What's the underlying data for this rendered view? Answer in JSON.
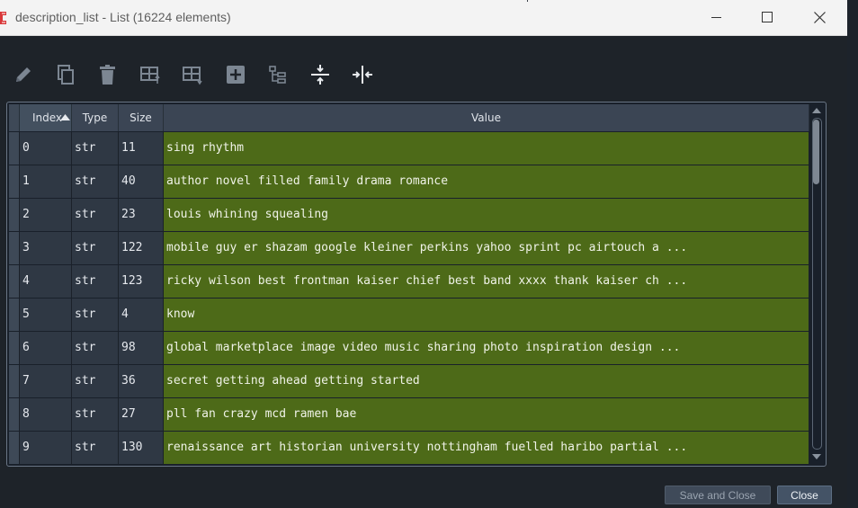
{
  "window": {
    "title": "description_list - List (16224 elements)",
    "icon": "app-icon"
  },
  "controls": {
    "minimize": "minimize-icon",
    "maximize": "maximize-icon",
    "close": "close-icon"
  },
  "toolbar": {
    "buttons": [
      {
        "name": "edit-button",
        "icon": "pencil-icon"
      },
      {
        "name": "copy-button",
        "icon": "copy-icon"
      },
      {
        "name": "delete-button",
        "icon": "trash-icon"
      },
      {
        "name": "insert-above-button",
        "icon": "insert-row-above-icon"
      },
      {
        "name": "insert-below-button",
        "icon": "insert-row-below-icon"
      },
      {
        "name": "add-button",
        "icon": "plus-square-icon"
      },
      {
        "name": "tree-view-button",
        "icon": "tree-icon"
      },
      {
        "name": "resize-rows-button",
        "icon": "compress-vertical-icon"
      },
      {
        "name": "resize-columns-button",
        "icon": "compress-horizontal-icon"
      }
    ]
  },
  "table": {
    "columns": [
      "Index",
      "Type",
      "Size",
      "Value"
    ],
    "sort_column": "Index",
    "sort_direction": "ascending",
    "rows": [
      {
        "index": "0",
        "type": "str",
        "size": "11",
        "value": "sing rhythm"
      },
      {
        "index": "1",
        "type": "str",
        "size": "40",
        "value": "author novel filled family drama romance"
      },
      {
        "index": "2",
        "type": "str",
        "size": "23",
        "value": "louis whining squealing"
      },
      {
        "index": "3",
        "type": "str",
        "size": "122",
        "value": "mobile guy er shazam google kleiner perkins yahoo sprint pc airtouch a ..."
      },
      {
        "index": "4",
        "type": "str",
        "size": "123",
        "value": "ricky wilson best frontman kaiser chief best band xxxx thank kaiser ch ..."
      },
      {
        "index": "5",
        "type": "str",
        "size": "4",
        "value": "know"
      },
      {
        "index": "6",
        "type": "str",
        "size": "98",
        "value": "global marketplace image video music sharing photo inspiration design ..."
      },
      {
        "index": "7",
        "type": "str",
        "size": "36",
        "value": "secret getting ahead getting started"
      },
      {
        "index": "8",
        "type": "str",
        "size": "27",
        "value": "pll fan crazy mcd ramen bae"
      },
      {
        "index": "9",
        "type": "str",
        "size": "130",
        "value": "renaissance art historian university nottingham fuelled haribo partial ..."
      }
    ]
  },
  "footer": {
    "save_label": "Save and Close",
    "close_label": "Close"
  },
  "colors": {
    "value_cell": "#4d6a18",
    "cell_bg": "#2f3844",
    "header_bg": "#3b4554",
    "window_bg": "#1e2329"
  }
}
